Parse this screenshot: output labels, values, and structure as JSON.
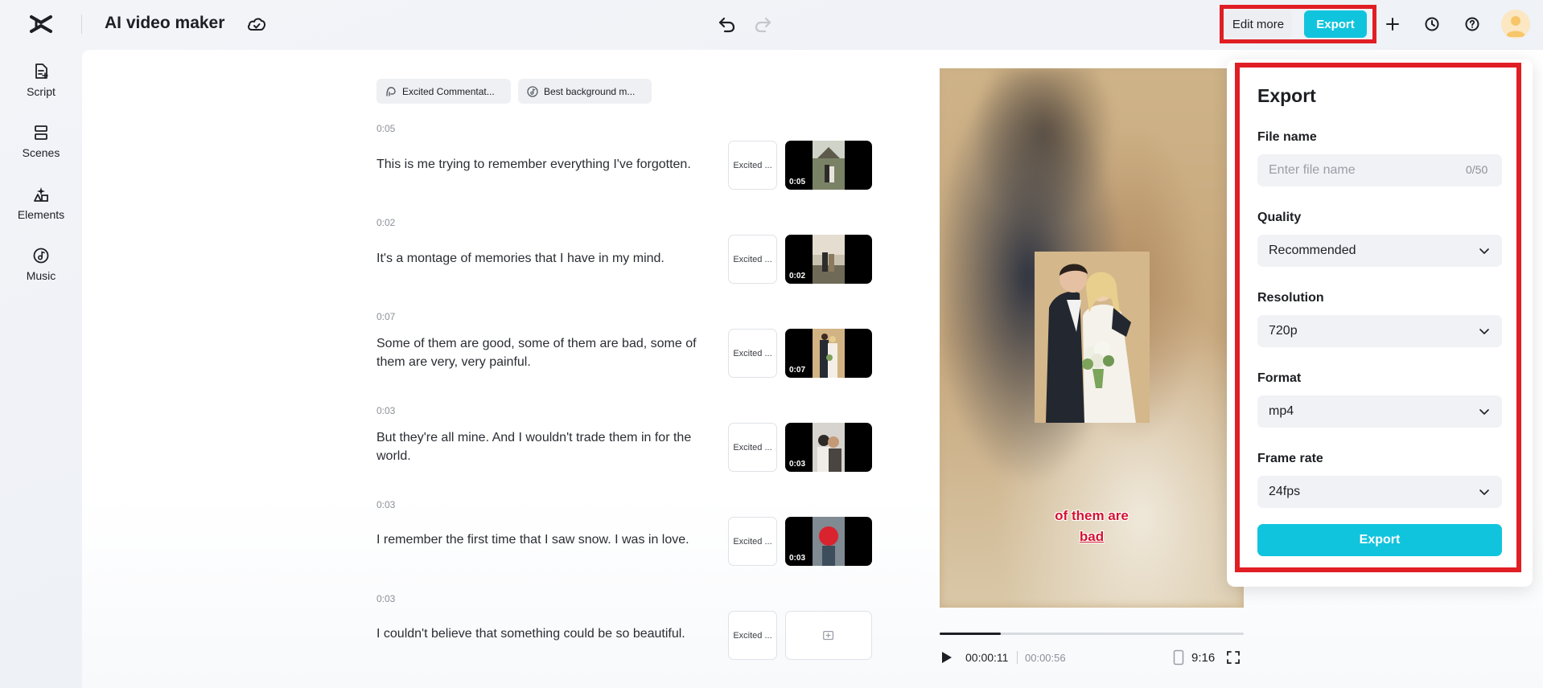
{
  "header": {
    "title": "AI video maker",
    "edit_more_label": "Edit more",
    "export_label": "Export"
  },
  "sidebar": {
    "items": [
      {
        "label": "Script",
        "icon": "script-icon"
      },
      {
        "label": "Scenes",
        "icon": "scenes-icon"
      },
      {
        "label": "Elements",
        "icon": "elements-icon"
      },
      {
        "label": "Music",
        "icon": "music-icon"
      }
    ]
  },
  "script": {
    "voice_chip": "Excited Commentat...",
    "music_chip": "Best background m...",
    "scenes": [
      {
        "time": "0:05",
        "text": "This is me trying to remember everything I've forgotten.",
        "voice": "Excited ...",
        "duration": "0:05"
      },
      {
        "time": "0:02",
        "text": "It's a montage of memories that I have in my mind.",
        "voice": "Excited ...",
        "duration": "0:02"
      },
      {
        "time": "0:07",
        "text": "Some of them are good, some of them are bad, some of them are very, very painful.",
        "voice": "Excited ...",
        "duration": "0:07"
      },
      {
        "time": "0:03",
        "text": "But they're all mine. And I wouldn't trade them in for the world.",
        "voice": "Excited ...",
        "duration": "0:03"
      },
      {
        "time": "0:03",
        "text": "I remember the first time that I saw snow. I was in love.",
        "voice": "Excited ...",
        "duration": "0:03"
      },
      {
        "time": "0:03",
        "text": "I couldn't believe that something could be so beautiful.",
        "voice": "Excited ...",
        "duration": ""
      }
    ]
  },
  "preview": {
    "caption_line1": "of them are",
    "caption_line2": "bad",
    "current_time": "00:00:11",
    "total_time": "00:00:56",
    "progress": 0.2,
    "aspect_ratio": "9:16"
  },
  "export": {
    "title": "Export",
    "file_name_label": "File name",
    "file_name_placeholder": "Enter file name",
    "file_name_value": "",
    "char_count": "0/50",
    "quality_label": "Quality",
    "quality_value": "Recommended",
    "resolution_label": "Resolution",
    "resolution_value": "720p",
    "format_label": "Format",
    "format_value": "mp4",
    "frame_rate_label": "Frame rate",
    "frame_rate_value": "24fps",
    "button_label": "Export"
  },
  "colors": {
    "accent": "#11c4dd",
    "highlight_outline": "#e01e24",
    "caption": "#d4122f"
  }
}
